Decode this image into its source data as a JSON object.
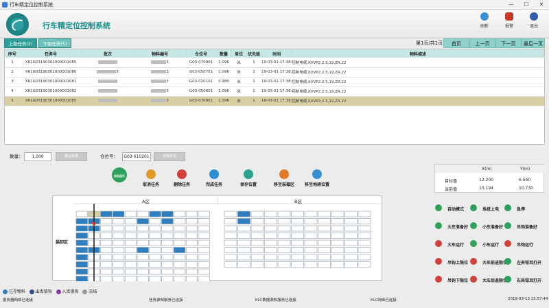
{
  "window": {
    "title": "行车精定位控制系统",
    "min": "—",
    "max": "☐",
    "close": "✕"
  },
  "header": {
    "title": "行车精定位控制系统",
    "icons": [
      {
        "name": "refresh-icon",
        "label": "刷新",
        "color": "#3a8fd0"
      },
      {
        "name": "alarm-icon",
        "label": "报警",
        "color": "#c93a2a"
      },
      {
        "name": "exit-icon",
        "label": "退出",
        "color": "#2d5fa8"
      }
    ]
  },
  "tabs": [
    {
      "label": "上架任务(2)",
      "active": true
    },
    {
      "label": "下架任务(5)",
      "active": false
    }
  ],
  "pager": {
    "info": "第1页/共1页",
    "first": "首页",
    "prev": "上一页",
    "next": "下一页",
    "last": "最后一页"
  },
  "table": {
    "headers": [
      "序号",
      "任务号",
      "批次",
      "物料编号",
      "仓位号",
      "数量",
      "单位",
      "优先级",
      "时间",
      "物料描述"
    ],
    "rows": [
      {
        "no": "1",
        "task": "XR1G03190301000001085",
        "batch": "",
        "mat": "3",
        "loc": "G03-070901",
        "qty": "1.096",
        "unit": "米",
        "pri": "1",
        "time": "19-03-01 17:38:",
        "desc": "控制电缆,KVVP2,2.5,19,ZR,22"
      },
      {
        "no": "2",
        "task": "XR1G03190301000001086",
        "batch": "3",
        "mat": "3",
        "loc": "G03-050701",
        "qty": "1.096",
        "unit": "米",
        "pri": "1",
        "time": "19-03-01 17:38:",
        "desc": "控制电缆,KVVP2,2.5,19,ZR,22"
      },
      {
        "no": "3",
        "task": "XR1G03190301000001081",
        "batch": "",
        "mat": "3",
        "loc": "G03-020101",
        "qty": "0.980",
        "unit": "米",
        "pri": "1",
        "time": "19-03-01 17:38:",
        "desc": "控制电缆,KVVP2,2.5,19,ZR,22"
      },
      {
        "no": "4",
        "task": "XR1G03190301000001082",
        "batch": "",
        "mat": "3",
        "loc": "G03-050601",
        "qty": "1.096",
        "unit": "米",
        "pri": "1",
        "time": "19-03-01 17:38:",
        "desc": "控制电缆,KVVP2,2.5,19,ZR,22"
      },
      {
        "no": "5",
        "task": "XR1G03190301000001085",
        "batch": "",
        "mat": "3",
        "loc": "G03-070901",
        "qty": "1.096",
        "unit": "米",
        "pri": "1",
        "time": "19-03-01 17:38:",
        "desc": "控制电缆,KVVP2,2.5,19,ZR,22",
        "selected": true
      }
    ]
  },
  "controls": {
    "qty_label": "数量：",
    "qty_value": "1.000",
    "confirm_qty": "确认数量",
    "loc_label": "仓位号：",
    "loc_value": "G03-010201",
    "confirm_loc": "点我定位"
  },
  "actions": [
    {
      "label": "启动运行",
      "color": "#2ea05a",
      "active": true
    },
    {
      "label": "取消任务",
      "color": "#e09a2a"
    },
    {
      "label": "删除任务",
      "color": "#d0413a"
    },
    {
      "label": "完成任务",
      "color": "#2d8fd0"
    },
    {
      "label": "保存位置",
      "color": "#2aa08e"
    },
    {
      "label": "移至装载区",
      "color": "#e07a2a"
    },
    {
      "label": "移至地磅位置",
      "color": "#3a8fd0"
    }
  ],
  "warehouse": {
    "zone_a": "A区",
    "zone_b": "B区",
    "loading_label": "装卸区"
  },
  "legend": [
    {
      "label": "已存物料",
      "color": "#2d7fc0"
    },
    {
      "label": "出库锁钩",
      "color": "#2d4a8a"
    },
    {
      "label": "入库锁钩",
      "color": "#8a3ab0"
    },
    {
      "label": "冻结",
      "color": "#999999"
    }
  ],
  "coords": {
    "x_header": "X(m)",
    "y_header": "Y(m)",
    "target_label": "目标值",
    "target_x": "12.200",
    "target_y": "6.540",
    "current_label": "当前值",
    "current_x": "13.194",
    "current_y": "10.730"
  },
  "status": [
    {
      "label": "自动模式",
      "color": "#2ea05a"
    },
    {
      "label": "系统上电",
      "color": "#2ea05a"
    },
    {
      "label": "急停",
      "color": "#2ea05a"
    },
    {
      "label": "大车准备好",
      "color": "#2ea05a"
    },
    {
      "label": "小车准备好",
      "color": "#2ea05a"
    },
    {
      "label": "吊钩准备好",
      "color": "#2ea05a"
    },
    {
      "label": "大车运行",
      "color": "#d0413a"
    },
    {
      "label": "小车运行",
      "color": "#2ea05a"
    },
    {
      "label": "吊钩运行",
      "color": "#d0413a"
    },
    {
      "label": "吊钩上限位",
      "color": "#d0413a"
    },
    {
      "label": "大车前进限位",
      "color": "#d0413a"
    },
    {
      "label": "左夹钳耳打开",
      "color": "#2ea05a"
    },
    {
      "label": "吊钩下限位",
      "color": "#d0413a"
    },
    {
      "label": "大车后退限位",
      "color": "#d0413a"
    },
    {
      "label": "右夹钳耳打开",
      "color": "#2ea05a"
    }
  ],
  "statusbar": {
    "s1": "服务器网络已连接",
    "s2": "任务源知服务已连接",
    "s3": "PLC数据源知服务已连接",
    "s4": "PLC网络已连接",
    "time": "2019-03-13 15:57:44"
  }
}
